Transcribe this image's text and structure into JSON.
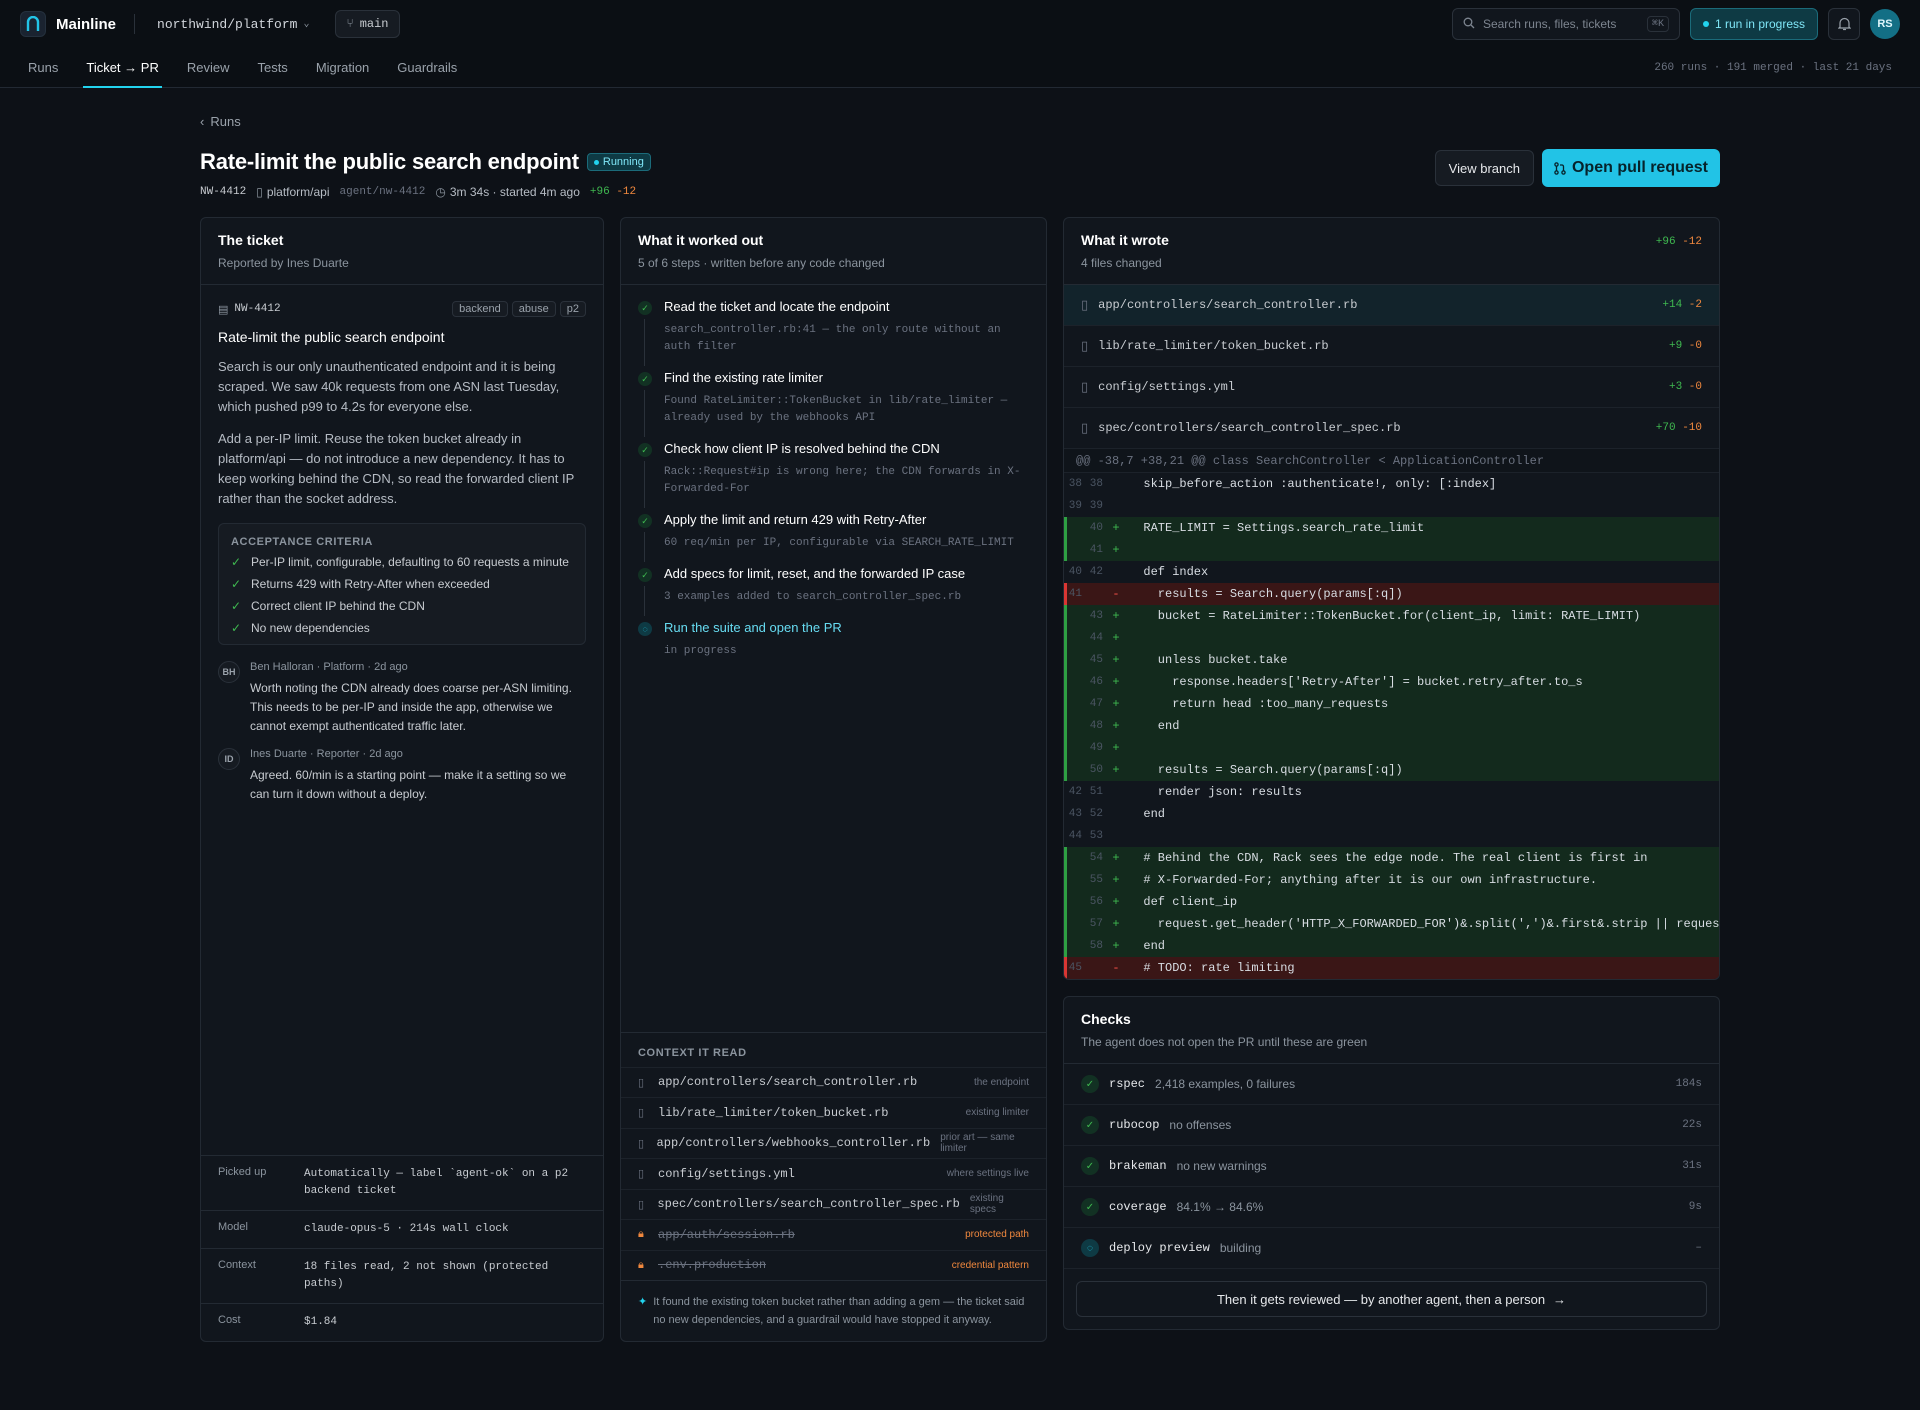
{
  "app": {
    "name": "Mainline",
    "repo": "northwind/platform",
    "branch": "main"
  },
  "topbar": {
    "search_placeholder": "Search runs, files, tickets",
    "search_shortcut": "⌘K",
    "run_status": "1 run in progress",
    "user_initials": "RS"
  },
  "nav": {
    "tabs": [
      "Runs",
      "Ticket → PR",
      "Review",
      "Tests",
      "Migration",
      "Guardrails"
    ],
    "active_tab": "Ticket → PR",
    "stats": "260 runs · 191 merged · last 21 days"
  },
  "breadcrumb": "Runs",
  "run": {
    "title": "Rate-limit the public search endpoint",
    "status": "Running",
    "ticket_id": "NW-4412",
    "repo": "platform/api",
    "branch": "agent/nw-4412",
    "duration": "3m 34s · started 4m ago",
    "additions": "+96",
    "deletions": "-12",
    "view_branch_label": "View branch",
    "open_pr_label": "Open pull request"
  },
  "ticket": {
    "heading": "The ticket",
    "reporter": "Reported by Ines Duarte",
    "id": "NW-4412",
    "tags": [
      "backend",
      "abuse",
      "p2"
    ],
    "title": "Rate-limit the public search endpoint",
    "paragraphs": [
      "Search is our only unauthenticated endpoint and it is being scraped. We saw 40k requests from one ASN last Tuesday, which pushed p99 to 4.2s for everyone else.",
      "Add a per-IP limit. Reuse the token bucket already in platform/api — do not introduce a new dependency. It has to keep working behind the CDN, so read the forwarded client IP rather than the socket address."
    ],
    "criteria_heading": "ACCEPTANCE CRITERIA",
    "criteria": [
      "Per-IP limit, configurable, defaulting to 60 requests a minute",
      "Returns 429 with Retry-After when exceeded",
      "Correct client IP behind the CDN",
      "No new dependencies"
    ],
    "comments": [
      {
        "initials": "BH",
        "meta": "Ben Halloran · Platform · 2d ago",
        "text": "Worth noting the CDN already does coarse per-ASN limiting. This needs to be per-IP and inside the app, otherwise we cannot exempt authenticated traffic later."
      },
      {
        "initials": "ID",
        "meta": "Ines Duarte · Reporter · 2d ago",
        "text": "Agreed. 60/min is a starting point — make it a setting so we can turn it down without a deploy."
      }
    ],
    "details": [
      {
        "key": "Picked up",
        "value": "Automatically — label `agent-ok` on a p2 backend ticket"
      },
      {
        "key": "Model",
        "value": "claude-opus-5 · 214s wall clock"
      },
      {
        "key": "Context",
        "value": "18 files read, 2 not shown (protected paths)"
      },
      {
        "key": "Cost",
        "value": "$1.84"
      }
    ]
  },
  "plan": {
    "heading": "What it worked out",
    "sub": "5 of 6 steps · written before any code changed",
    "steps": [
      {
        "title": "Read the ticket and locate the endpoint",
        "note": "search_controller.rb:41 — the only route without an auth filter",
        "state": "done"
      },
      {
        "title": "Find the existing rate limiter",
        "note": "Found RateLimiter::TokenBucket in lib/rate_limiter — already used by the webhooks API",
        "state": "done"
      },
      {
        "title": "Check how client IP is resolved behind the CDN",
        "note": "Rack::Request#ip is wrong here; the CDN forwards in X-Forwarded-For",
        "state": "done"
      },
      {
        "title": "Apply the limit and return 429 with Retry-After",
        "note": "60 req/min per IP, configurable via SEARCH_RATE_LIMIT",
        "state": "done"
      },
      {
        "title": "Add specs for limit, reset, and the forwarded IP case",
        "note": "3 examples added to search_controller_spec.rb",
        "state": "done"
      },
      {
        "title": "Run the suite and open the PR",
        "note": "in progress",
        "state": "running"
      }
    ],
    "context_heading": "CONTEXT IT READ",
    "context": [
      {
        "file": "app/controllers/search_controller.rb",
        "why": "the endpoint",
        "blocked": false
      },
      {
        "file": "lib/rate_limiter/token_bucket.rb",
        "why": "existing limiter",
        "blocked": false
      },
      {
        "file": "app/controllers/webhooks_controller.rb",
        "why": "prior art — same limiter",
        "blocked": false
      },
      {
        "file": "config/settings.yml",
        "why": "where settings live",
        "blocked": false
      },
      {
        "file": "spec/controllers/search_controller_spec.rb",
        "why": "existing specs",
        "blocked": false
      },
      {
        "file": "app/auth/session.rb",
        "why": "protected path",
        "blocked": true
      },
      {
        "file": ".env.production",
        "why": "credential pattern",
        "blocked": true
      }
    ],
    "note": "It found the existing token bucket rather than adding a gem — the ticket said no new dependencies, and a guardrail would have stopped it anyway."
  },
  "diff": {
    "heading": "What it wrote",
    "sub": "4 files changed",
    "additions": "+96",
    "deletions": "-12",
    "files": [
      {
        "name": "app/controllers/search_controller.rb",
        "add": "+14",
        "del": "-2",
        "active": true
      },
      {
        "name": "lib/rate_limiter/token_bucket.rb",
        "add": "+9",
        "del": "-0",
        "active": false
      },
      {
        "name": "config/settings.yml",
        "add": "+3",
        "del": "-0",
        "active": false
      },
      {
        "name": "spec/controllers/search_controller_spec.rb",
        "add": "+70",
        "del": "-10",
        "active": false
      }
    ],
    "hunk": "@@ -38,7 +38,21 @@ class SearchController < ApplicationController",
    "lines": [
      {
        "old": "38",
        "new": "38",
        "type": "ctx",
        "text": "  skip_before_action :authenticate!, only: [:index]"
      },
      {
        "old": "39",
        "new": "39",
        "type": "ctx",
        "text": ""
      },
      {
        "old": "",
        "new": "40",
        "type": "add",
        "text": "  RATE_LIMIT = Settings.search_rate_limit"
      },
      {
        "old": "",
        "new": "41",
        "type": "add",
        "text": ""
      },
      {
        "old": "40",
        "new": "42",
        "type": "ctx",
        "text": "  def index"
      },
      {
        "old": "41",
        "new": "",
        "type": "del",
        "text": "    results = Search.query(params[:q])"
      },
      {
        "old": "",
        "new": "43",
        "type": "add",
        "text": "    bucket = RateLimiter::TokenBucket.for(client_ip, limit: RATE_LIMIT)"
      },
      {
        "old": "",
        "new": "44",
        "type": "add",
        "text": ""
      },
      {
        "old": "",
        "new": "45",
        "type": "add",
        "text": "    unless bucket.take"
      },
      {
        "old": "",
        "new": "46",
        "type": "add",
        "text": "      response.headers['Retry-After'] = bucket.retry_after.to_s"
      },
      {
        "old": "",
        "new": "47",
        "type": "add",
        "text": "      return head :too_many_requests"
      },
      {
        "old": "",
        "new": "48",
        "type": "add",
        "text": "    end"
      },
      {
        "old": "",
        "new": "49",
        "type": "add",
        "text": ""
      },
      {
        "old": "",
        "new": "50",
        "type": "add",
        "text": "    results = Search.query(params[:q])"
      },
      {
        "old": "42",
        "new": "51",
        "type": "ctx",
        "text": "    render json: results"
      },
      {
        "old": "43",
        "new": "52",
        "type": "ctx",
        "text": "  end"
      },
      {
        "old": "44",
        "new": "53",
        "type": "ctx",
        "text": ""
      },
      {
        "old": "",
        "new": "54",
        "type": "add",
        "text": "  # Behind the CDN, Rack sees the edge node. The real client is first in"
      },
      {
        "old": "",
        "new": "55",
        "type": "add",
        "text": "  # X-Forwarded-For; anything after it is our own infrastructure."
      },
      {
        "old": "",
        "new": "56",
        "type": "add",
        "text": "  def client_ip"
      },
      {
        "old": "",
        "new": "57",
        "type": "add",
        "text": "    request.get_header('HTTP_X_FORWARDED_FOR')&.split(',')&.first&.strip || request.ip"
      },
      {
        "old": "",
        "new": "58",
        "type": "add",
        "text": "  end"
      },
      {
        "old": "45",
        "new": "",
        "type": "del",
        "text": "  # TODO: rate limiting"
      }
    ]
  },
  "checks": {
    "heading": "Checks",
    "sub": "The agent does not open the PR until these are green",
    "items": [
      {
        "name": "rspec",
        "detail": "2,418 examples, 0 failures",
        "time": "184s",
        "state": "pass"
      },
      {
        "name": "rubocop",
        "detail": "no offenses",
        "time": "22s",
        "state": "pass"
      },
      {
        "name": "brakeman",
        "detail": "no new warnings",
        "time": "31s",
        "state": "pass"
      },
      {
        "name": "coverage",
        "detail": "84.1% → 84.6%",
        "time": "9s",
        "state": "pass"
      },
      {
        "name": "deploy preview",
        "detail": "building",
        "time": "–",
        "state": "building"
      }
    ],
    "review_label": "Then it gets reviewed — by another agent, then a person"
  }
}
